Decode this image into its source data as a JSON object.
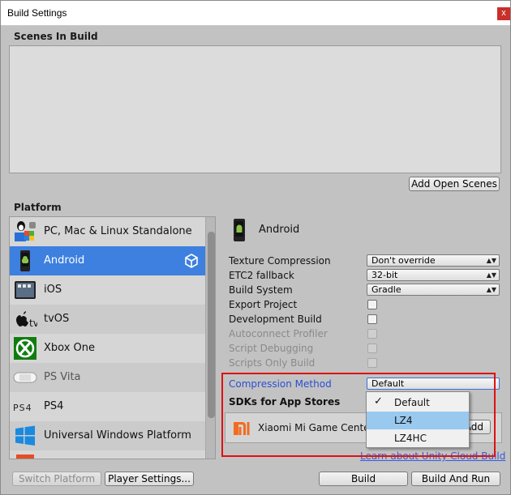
{
  "window": {
    "title": "Build Settings",
    "close_label": "x"
  },
  "scenes": {
    "header": "Scenes In Build",
    "add_open_scenes": "Add Open Scenes"
  },
  "platform": {
    "header": "Platform",
    "items": [
      {
        "label": "PC, Mac & Linux Standalone",
        "icon": "pc-mac-linux-icon"
      },
      {
        "label": "Android",
        "icon": "android-icon",
        "selected": true
      },
      {
        "label": "iOS",
        "icon": "ios-icon"
      },
      {
        "label": "tvOS",
        "icon": "tvos-icon"
      },
      {
        "label": "Xbox One",
        "icon": "xbox-icon"
      },
      {
        "label": "PS Vita",
        "icon": "ps-vita-icon"
      },
      {
        "label": "PS4",
        "icon": "ps4-icon"
      },
      {
        "label": "Universal Windows Platform",
        "icon": "windows-icon"
      }
    ]
  },
  "settings": {
    "platform_title": "Android",
    "texture_compression": {
      "label": "Texture Compression",
      "value": "Don't override"
    },
    "etc2_fallback": {
      "label": "ETC2 fallback",
      "value": "32-bit"
    },
    "build_system": {
      "label": "Build System",
      "value": "Gradle"
    },
    "export_project": {
      "label": "Export Project"
    },
    "development_build": {
      "label": "Development Build"
    },
    "autoconnect_profiler": {
      "label": "Autoconnect Profiler"
    },
    "script_debugging": {
      "label": "Script Debugging"
    },
    "scripts_only_build": {
      "label": "Scripts Only Build"
    },
    "compression_method": {
      "label": "Compression Method",
      "value": "Default"
    },
    "sdks_header": "SDKs for App Stores",
    "sdk_name": "Xiaomi Mi Game Center",
    "sdk_add_button": "Add",
    "cloud_build_link": "Learn about Unity Cloud Build"
  },
  "compression_menu": {
    "options": [
      "Default",
      "LZ4",
      "LZ4HC"
    ],
    "checked": "Default",
    "highlighted": "LZ4"
  },
  "footer": {
    "switch_platform": "Switch Platform",
    "player_settings": "Player Settings...",
    "build": "Build",
    "build_and_run": "Build And Run"
  },
  "colors": {
    "selected_row": "#3d80df",
    "highlight_outline": "#e01010",
    "menu_hover": "#99c9ef"
  }
}
